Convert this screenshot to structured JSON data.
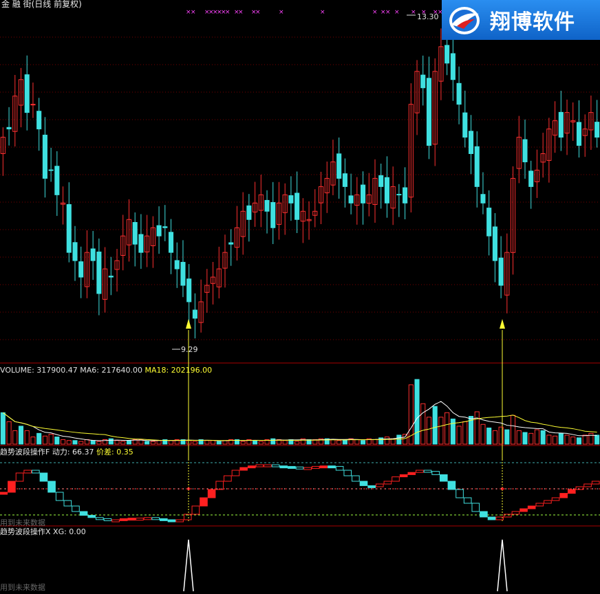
{
  "title": "金 融 街(日线 前复权)",
  "price_panel": {
    "high_label": "13.30",
    "low_label": "9.29"
  },
  "volume_panel": {
    "volume_label": "VOLUME: 317900.47",
    "ma6_label": "MA6: 217640.00",
    "ma18_label": "MA18: 202196.00"
  },
  "trend_panel": {
    "name": "趋势波段操作F",
    "power_label": "动力: 66.37",
    "diff_label": "价差: 0.35",
    "note": "用到未来数据"
  },
  "xg_panel": {
    "name": "趋势波段操作X",
    "xg_label": "XG: 0.00",
    "note": "用到未来数据"
  },
  "logo": {
    "text": "翔博软件",
    "icon": "bird-globe-logo-icon"
  },
  "colors": {
    "up": "#ff3030",
    "down": "#3fe0e0",
    "grid": "#7a0000",
    "ma6": "#ffffff",
    "ma18": "#ffff33",
    "marker": "#ffff33",
    "x_marks": "#ff44ff"
  },
  "chart_data": {
    "type": "candlestick",
    "close": [
      11.8,
      11.9,
      12.3,
      12.5,
      12.1,
      12.2,
      11.9,
      11.3,
      11.4,
      11.1,
      11.0,
      10.4,
      10.3,
      10.1,
      10.4,
      10.3,
      9.9,
      10.2,
      10.1,
      10.3,
      10.6,
      10.8,
      10.5,
      10.4,
      10.6,
      10.7,
      10.6,
      10.7,
      10.4,
      10.2,
      10.0,
      9.8,
      9.6,
      9.8,
      10.0,
      10.1,
      10.2,
      10.4,
      10.5,
      10.7,
      10.9,
      10.8,
      11.0,
      11.1,
      10.9,
      10.7,
      11.0,
      11.1,
      11.0,
      10.8,
      10.9,
      10.8,
      10.9,
      11.2,
      11.3,
      11.5,
      11.3,
      11.2,
      11.0,
      11.1,
      11.0,
      11.1,
      11.3,
      11.2,
      11.0,
      11.2,
      11.1,
      11.0,
      12.2,
      12.6,
      12.4,
      11.7,
      12.6,
      12.9,
      12.7,
      12.5,
      12.2,
      11.8,
      11.6,
      11.2,
      11.0,
      10.6,
      10.3,
      10.0,
      10.4,
      11.3,
      11.8,
      11.5,
      11.2,
      11.4,
      11.6,
      11.9,
      12.0,
      11.8,
      12.1,
      12.0,
      11.7,
      11.9,
      12.1,
      11.8
    ],
    "volume": [
      3.5,
      2.5,
      1.5,
      2.0,
      1.5,
      0.8,
      1.2,
      0.9,
      1.1,
      0.8,
      0.5,
      0.4,
      0.4,
      0.3,
      0.5,
      0.4,
      0.3,
      0.5,
      0.6,
      0.4,
      0.3,
      0.4,
      0.5,
      0.5,
      0.3,
      0.3,
      0.4,
      0.5,
      0.4,
      0.5,
      0.5,
      0.4,
      0.3,
      0.5,
      0.4,
      0.4,
      0.3,
      0.4,
      0.5,
      0.5,
      0.3,
      0.5,
      0.4,
      0.3,
      0.5,
      0.6,
      0.5,
      0.4,
      0.5,
      0.3,
      0.6,
      0.5,
      0.5,
      0.6,
      0.6,
      0.5,
      0.4,
      0.5,
      0.6,
      0.5,
      0.4,
      0.6,
      0.5,
      0.7,
      0.8,
      0.6,
      1.0,
      1.1,
      6.6,
      7.2,
      4.5,
      3.0,
      4.2,
      3.0,
      3.5,
      2.8,
      2.0,
      2.5,
      3.1,
      3.6,
      2.2,
      1.8,
      1.5,
      1.9,
      1.6,
      3.2,
      1.5,
      1.3,
      1.2,
      1.6,
      1.5,
      1.0,
      0.9,
      1.2,
      1.0,
      0.8,
      0.7,
      1.0,
      1.2,
      1.0
    ],
    "trend": [
      0.5,
      0.7,
      0.85,
      0.9,
      0.85,
      0.7,
      0.5,
      0.35,
      0.25,
      0.15,
      0.08,
      0.04,
      0.02,
      0.0,
      0.0,
      0.02,
      0.03,
      0.03,
      0.04,
      0.02,
      0.0,
      -0.02,
      0.0,
      0.1,
      0.25,
      0.4,
      0.55,
      0.7,
      0.8,
      0.9,
      0.95,
      0.98,
      1.0,
      1.0,
      0.98,
      0.97,
      0.96,
      0.95,
      0.95,
      0.97,
      0.98,
      0.97,
      0.9,
      0.8,
      0.7,
      0.62,
      0.6,
      0.65,
      0.7,
      0.78,
      0.82,
      0.86,
      0.9,
      0.88,
      0.82,
      0.7,
      0.55,
      0.4,
      0.3,
      0.15,
      0.05,
      0.0,
      0.05,
      0.1,
      0.15,
      0.2,
      0.25,
      0.3,
      0.35,
      0.4,
      0.48,
      0.55,
      0.6,
      0.65,
      0.7
    ],
    "signals": [
      274,
      730
    ]
  }
}
